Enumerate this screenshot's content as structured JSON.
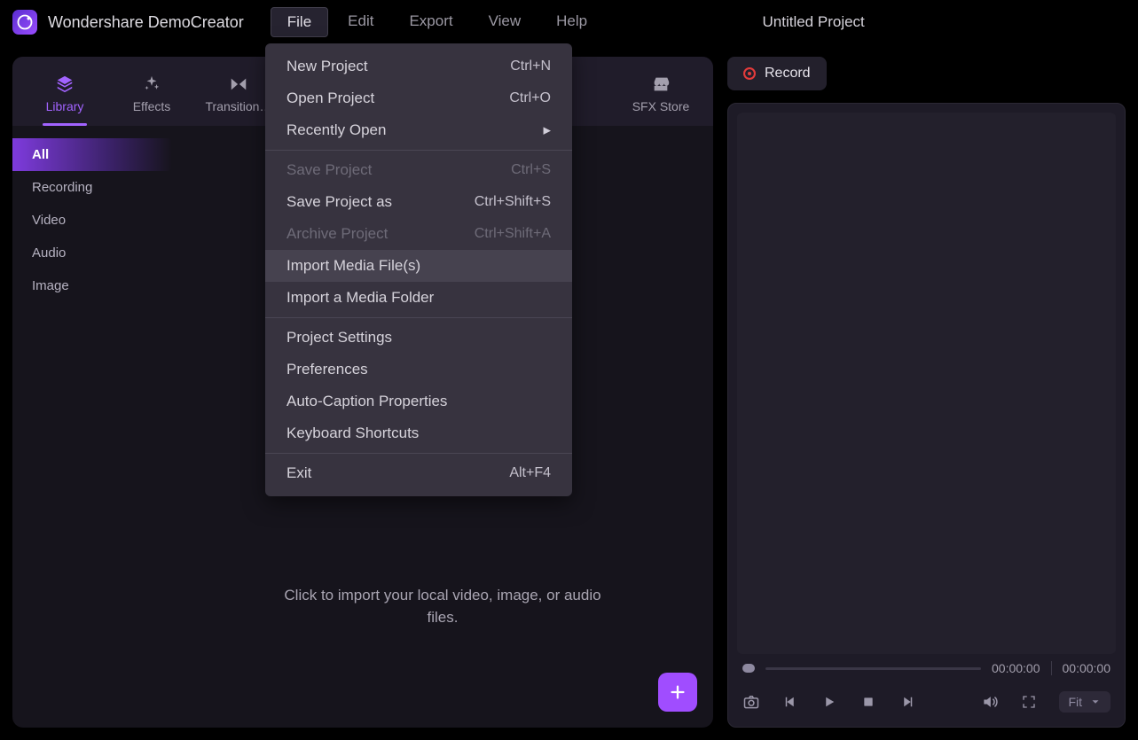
{
  "app_title": "Wondershare DemoCreator",
  "project_title": "Untitled Project",
  "menubar": [
    "File",
    "Edit",
    "Export",
    "View",
    "Help"
  ],
  "menubar_active": 0,
  "toptabs": [
    {
      "label": "Library",
      "icon": "library"
    },
    {
      "label": "Effects",
      "icon": "effects"
    },
    {
      "label": "Transition…",
      "icon": "transition"
    },
    {
      "label": "SFX Store",
      "icon": "store"
    }
  ],
  "toptab_active": 0,
  "sidebar": {
    "items": [
      "All",
      "Recording",
      "Video",
      "Audio",
      "Image"
    ],
    "active": 0
  },
  "drop_text": "Click to import your local video, image, or audio files.",
  "record_label": "Record",
  "preview": {
    "time_current": "00:00:00",
    "time_total": "00:00:00",
    "fit_label": "Fit"
  },
  "file_menu": [
    {
      "type": "item",
      "label": "New Project",
      "shortcut": "Ctrl+N"
    },
    {
      "type": "item",
      "label": "Open Project",
      "shortcut": "Ctrl+O"
    },
    {
      "type": "submenu",
      "label": "Recently Open"
    },
    {
      "type": "sep"
    },
    {
      "type": "item",
      "label": "Save Project",
      "shortcut": "Ctrl+S",
      "disabled": true
    },
    {
      "type": "item",
      "label": "Save Project as",
      "shortcut": "Ctrl+Shift+S"
    },
    {
      "type": "item",
      "label": "Archive Project",
      "shortcut": "Ctrl+Shift+A",
      "disabled": true
    },
    {
      "type": "item",
      "label": "Import Media File(s)",
      "shortcut": "",
      "hover": true
    },
    {
      "type": "item",
      "label": "Import a Media Folder",
      "shortcut": ""
    },
    {
      "type": "sep"
    },
    {
      "type": "item",
      "label": "Project Settings",
      "shortcut": ""
    },
    {
      "type": "item",
      "label": "Preferences",
      "shortcut": ""
    },
    {
      "type": "item",
      "label": "Auto-Caption Properties",
      "shortcut": ""
    },
    {
      "type": "item",
      "label": "Keyboard Shortcuts",
      "shortcut": ""
    },
    {
      "type": "sep"
    },
    {
      "type": "item",
      "label": "Exit",
      "shortcut": "Alt+F4"
    }
  ]
}
